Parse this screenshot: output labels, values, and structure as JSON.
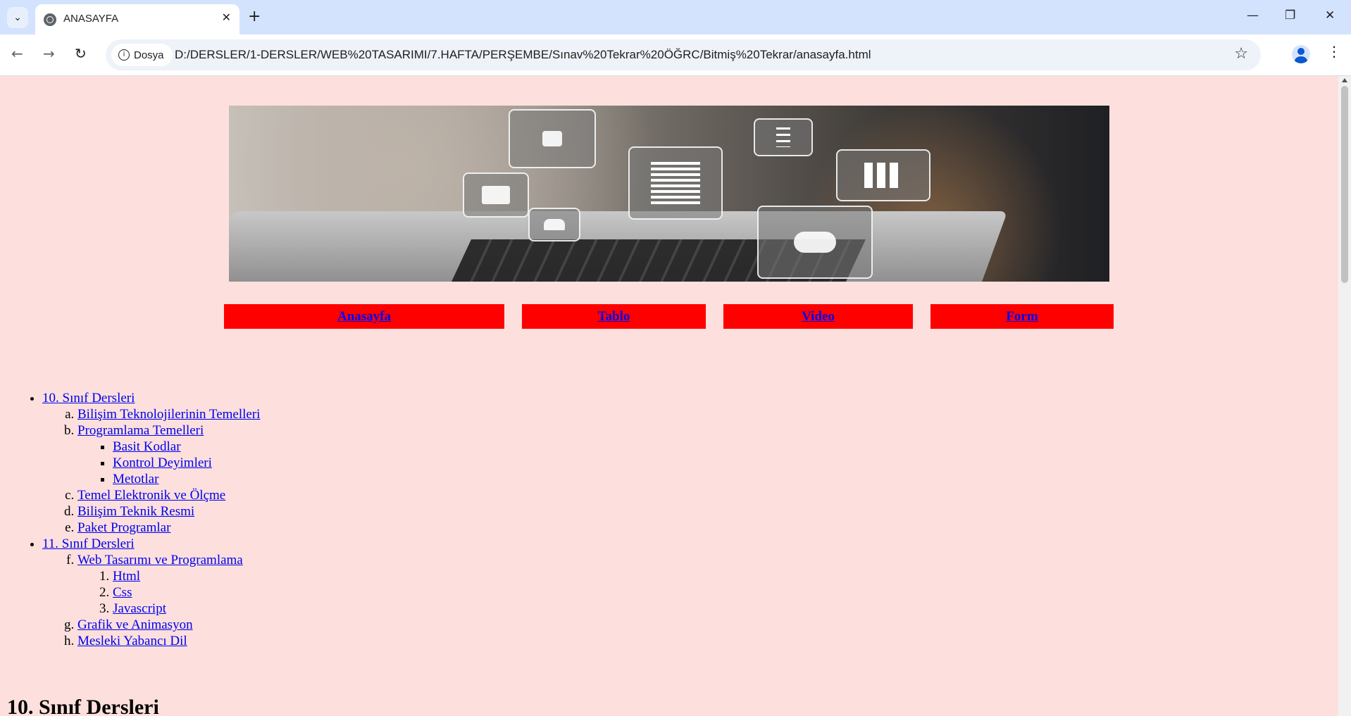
{
  "browser": {
    "tab_title": "ANASAYFA",
    "new_tab_glyph": "+",
    "security_chip": "Dosya",
    "url": "D:/DERSLER/1-DERSLER/WEB%20TASARIMI/7.HAFTA/PERŞEMBE/Sınav%20Tekrar%20ÖĞRC/Bitmiş%20Tekrar/anasayfa.html",
    "icons": [
      "tab-list-icon",
      "globe-icon",
      "close-icon",
      "plus-icon",
      "minimize-icon",
      "restore-icon",
      "window-close-icon",
      "back-icon",
      "forward-icon",
      "reload-icon",
      "info-icon",
      "star-icon",
      "profile-icon",
      "menu-icon"
    ]
  },
  "nav": {
    "items": [
      "Anasayfa",
      "Tablo",
      "Video",
      "Form"
    ]
  },
  "lists": {
    "grade10": "10. Sınıf Dersleri",
    "grade10_items": [
      "Bilişim Teknolojilerinin Temelleri",
      "Programlama Temelleri",
      "Temel Elektronik ve Ölçme",
      "Bilişim Teknik Resmi",
      "Paket Programlar"
    ],
    "programming_sub": [
      "Basit Kodlar",
      "Kontrol Deyimleri",
      "Metotlar"
    ],
    "grade11": "11. Sınıf Dersleri",
    "grade11_items": [
      "Web Tasarımı ve Programlama",
      "Grafik ve Animasyon",
      "Mesleki Yabancı Dil"
    ],
    "web_sub": [
      "Html",
      "Css",
      "Javascript"
    ]
  },
  "section_heading": "10. Sınıf Dersleri",
  "colors": {
    "page_bg": "#fde0dd",
    "nav_bg": "#ff0000",
    "link": "#0000ee",
    "tabbar_bg": "#d3e3fd"
  }
}
